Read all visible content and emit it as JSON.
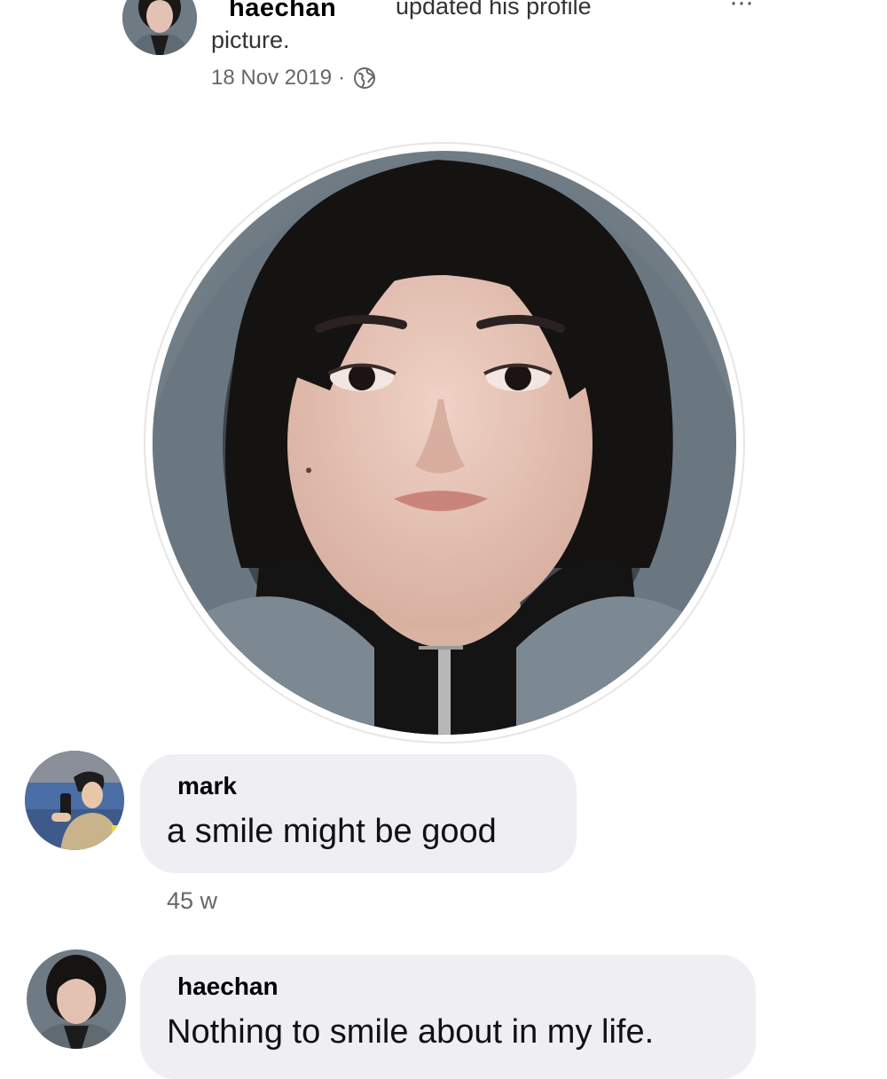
{
  "post": {
    "author": "haechan",
    "action_line1": "updated his profile",
    "action_line2": "picture.",
    "date": "18 Nov 2019",
    "separator": "·",
    "audience_icon": "globe-icon",
    "more_options": "···",
    "profile_picture": "portrait-photo"
  },
  "comments": [
    {
      "author": "mark",
      "text": "a smile might be good",
      "time": "45 w",
      "avatar": "avatar-photo"
    },
    {
      "author": "haechan",
      "text": "Nothing to smile about in my life.",
      "avatar": "avatar-photo"
    }
  ],
  "colors": {
    "bubble": "#efeff3",
    "meta_text": "#65676b",
    "hoodie": "#6f7b84",
    "hair": "#141212",
    "skin": "#e6c3b4"
  }
}
